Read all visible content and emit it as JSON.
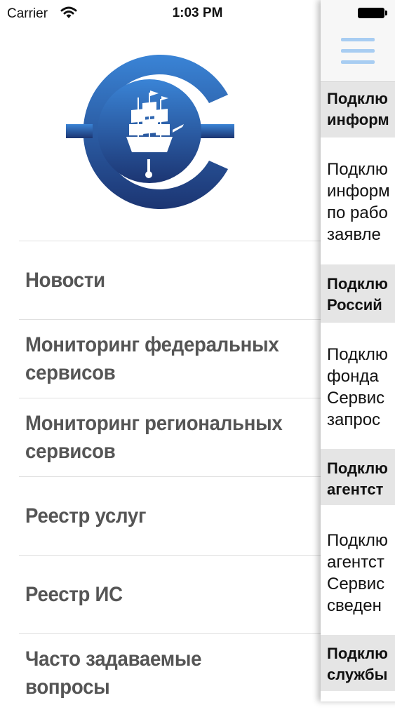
{
  "status_bar": {
    "carrier": "Carrier",
    "time": "1:03 PM"
  },
  "menu": {
    "items": [
      {
        "line1": "Новости",
        "line2": ""
      },
      {
        "line1": "Мониторинг федеральных",
        "line2": "сервисов"
      },
      {
        "line1": "Мониторинг региональных",
        "line2": "сервисов"
      },
      {
        "line1": "Реестр услуг",
        "line2": ""
      },
      {
        "line1": "Реестр ИС",
        "line2": ""
      },
      {
        "line1": "Часто задаваемые",
        "line2": "вопросы"
      }
    ]
  },
  "content": {
    "sections": [
      {
        "header": [
          "Подклю",
          "информ"
        ],
        "body": [
          "Подклю",
          "информ",
          "по рабо",
          "заявле"
        ]
      },
      {
        "header": [
          "Подклю",
          "Россий"
        ],
        "body": [
          "Подклю",
          "фонда",
          "Сервис",
          "запрос"
        ]
      },
      {
        "header": [
          "Подклю",
          "агентст"
        ],
        "body": [
          "Подклю",
          "агентст",
          "Сервис",
          "сведен"
        ]
      },
      {
        "header": [
          "Подклю",
          "службы"
        ],
        "body": []
      }
    ]
  },
  "colors": {
    "logo_blue_top": "#3a7fd0",
    "logo_blue_bottom": "#1c3a78",
    "hamburger": "#a8cdf2",
    "section_header_bg": "#e5e5e5",
    "menu_text": "#555555"
  },
  "icons": [
    "wifi-icon",
    "battery-icon",
    "hamburger-menu-icon",
    "logo-ship-emblem"
  ]
}
